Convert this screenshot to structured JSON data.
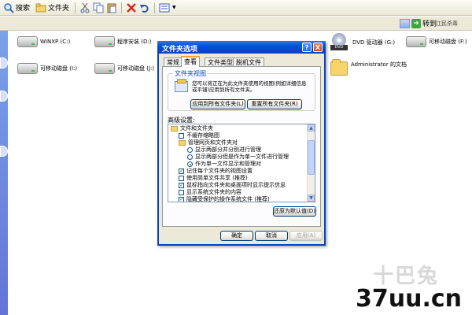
{
  "toolbar": {
    "search_label": "搜索",
    "folders_label": "文件夹"
  },
  "addressbar": {
    "go_label": "转到"
  },
  "drives": [
    {
      "label": "WINXP (C:)"
    },
    {
      "label": "程序安装 (D:)"
    },
    {
      "label": "可移动磁盘 (I:)"
    },
    {
      "label": "可移动磁盘 (J:)"
    },
    {
      "label": "DVD 驱动器 (G:)"
    },
    {
      "label": "可移动磁盘 (F:)"
    },
    {
      "label": "Administrator 的文档"
    }
  ],
  "dialog": {
    "title": "文件夹选项",
    "help": "?",
    "close": "X",
    "tabs": [
      "常规",
      "查看",
      "文件类型",
      "脱机文件"
    ],
    "group_title": "文件夹视图",
    "group_desc": "您可以将正在为此文件夹使用的视图(例如详细信息或平铺)应用到所有文件夹。",
    "apply_all": "应用到所有文件夹(L)",
    "reset_all": "重置所有文件夹(R)",
    "advanced_label": "高级设置:",
    "tree": [
      "文件和文件夹",
      "不缓存缩略图",
      "管理网页和文件夹对",
      "显示两部分并分别进行管理",
      "显示两部分但是作为单一文件进行管理",
      "作为单一文件显示和管理对",
      "记住每个文件夹的视图设置",
      "使用简单文件共享 (推荐)",
      "鼠标指向文件夹和桌面项时显示提示信息",
      "显示系统文件夹的内容",
      "隐藏受保护的操作系统文件 (推荐)"
    ],
    "restore_defaults": "还原为默认值(D)",
    "ok": "确定",
    "cancel": "取消",
    "apply": "应用(A)"
  },
  "watermark": {
    "brand_cn": "十巴兔",
    "url": "37uu.cn"
  },
  "colors": {
    "title_blue": "#0a4fd8",
    "check_green": "#21a121",
    "panel_bg": "#ece9d8"
  }
}
